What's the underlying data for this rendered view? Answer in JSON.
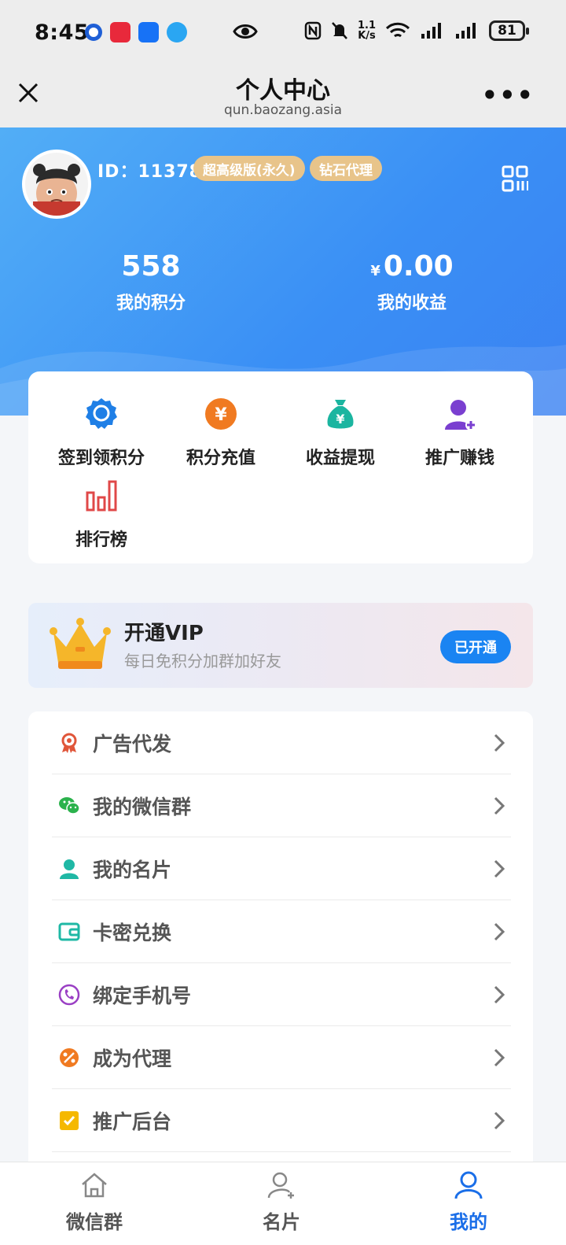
{
  "status_bar": {
    "time": "8:45",
    "network_speed_value": "1.1",
    "network_speed_unit": "K/s",
    "battery": "81"
  },
  "nav": {
    "title": "个人中心",
    "subtitle": "qun.baozang.asia"
  },
  "profile": {
    "id_label": "ID：11378",
    "badges": [
      "超高级版(永久)",
      "钻石代理"
    ]
  },
  "stats": {
    "points_value": "558",
    "points_label": "我的积分",
    "earnings_currency": "¥",
    "earnings_value": "0.00",
    "earnings_label": "我的收益"
  },
  "quick_actions": [
    {
      "label": "签到领积分",
      "icon": "badge-ribbon-icon",
      "color": "#1f7fe6"
    },
    {
      "label": "积分充值",
      "icon": "yen-coin-icon",
      "color": "#f07a21"
    },
    {
      "label": "收益提现",
      "icon": "money-bag-icon",
      "color": "#1bb5a0"
    },
    {
      "label": "推广赚钱",
      "icon": "user-add-icon",
      "color": "#7a3fd0"
    },
    {
      "label": "排行榜",
      "icon": "bar-chart-icon",
      "color": "#e04848"
    }
  ],
  "vip": {
    "title": "开通VIP",
    "subtitle": "每日免积分加群加好友",
    "button": "已开通"
  },
  "menu": [
    {
      "label": "广告代发",
      "icon": "award-icon",
      "color": "#e0563a"
    },
    {
      "label": "我的微信群",
      "icon": "wechat-icon",
      "color": "#2bb24c"
    },
    {
      "label": "我的名片",
      "icon": "user-icon",
      "color": "#1fb8a5"
    },
    {
      "label": "卡密兑换",
      "icon": "wallet-icon",
      "color": "#1fb8a5"
    },
    {
      "label": "绑定手机号",
      "icon": "phone-icon",
      "color": "#9a3fc4"
    },
    {
      "label": "成为代理",
      "icon": "agent-icon",
      "color": "#f07a21"
    },
    {
      "label": "推广后台",
      "icon": "checkbox-icon",
      "color": "#f5b800"
    }
  ],
  "tabs": [
    {
      "label": "微信群",
      "icon": "home-icon"
    },
    {
      "label": "名片",
      "icon": "user-plus-icon"
    },
    {
      "label": "我的",
      "icon": "person-icon",
      "active": true
    }
  ]
}
